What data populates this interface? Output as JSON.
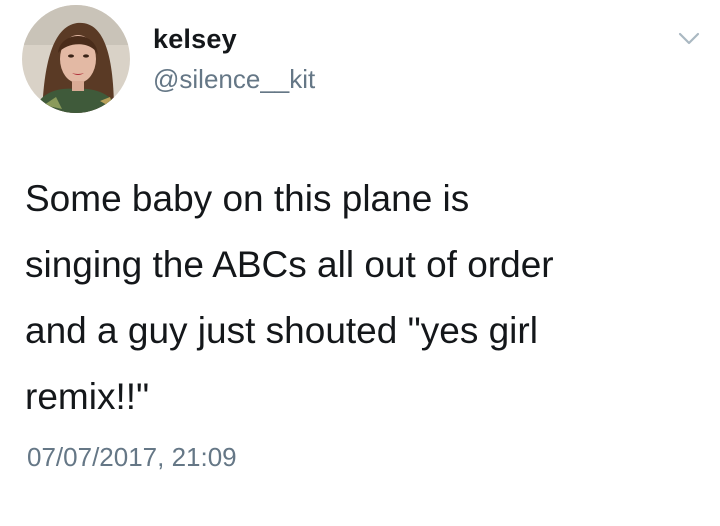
{
  "author": {
    "display_name": "kelsey",
    "handle": "@silence__kit",
    "avatar_icon": "profile-photo"
  },
  "menu": {
    "icon": "chevron-down-icon"
  },
  "tweet": {
    "lines": [
      "Some baby on this plane is",
      "singing the ABCs all out of order",
      "and a guy just shouted \"yes girl",
      "remix!!\""
    ],
    "timestamp": "07/07/2017, 21:09"
  },
  "colors": {
    "text": "#14171a",
    "secondary": "#657786",
    "chevron": "#aab8c2"
  }
}
